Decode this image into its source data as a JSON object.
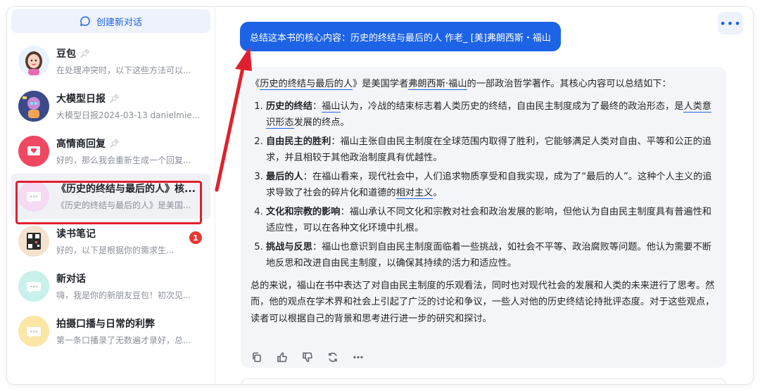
{
  "sidebar": {
    "new_chat_label": "创建新对话",
    "conversations": [
      {
        "title": "豆包",
        "preview": "在处理冲突时，以下这些方法可以...",
        "pinned": true,
        "avatar": "girl-avatar",
        "avatar_bg": "#e9f2ff"
      },
      {
        "title": "大模型日报",
        "preview": "大模型日报2024-03-13 danielmie...",
        "pinned": true,
        "avatar": "robot-avatar",
        "avatar_bg": "#3b4b8a"
      },
      {
        "title": "高情商回复",
        "preview": "好的，那么我会重新生成一个回复...",
        "pinned": true,
        "avatar": "heart-envelope-avatar",
        "avatar_bg": "#ef4860"
      },
      {
        "title": "《历史的终结与最后的人》核...",
        "preview": "《历史的终结与最后的人》是美国...",
        "pinned": false,
        "avatar": "chat-bubble-avatar",
        "avatar_bg": "#f6d9f3",
        "selected": true
      },
      {
        "title": "读书笔记",
        "preview": "好的，以下是根据你的需求生...",
        "pinned": false,
        "avatar": "qr-avatar",
        "avatar_bg": "#f4e2cf",
        "badge": "1"
      },
      {
        "title": "新对话",
        "preview": "嗨，我是你的新朋友豆包！初次见...",
        "pinned": false,
        "avatar": "chat-bubble-avatar",
        "avatar_bg": "#c7f1ea"
      },
      {
        "title": "拍摄口播与日常的利弊",
        "preview": "第一条口播录了无数遍才录好，总...",
        "pinned": false,
        "avatar": "chat-bubble-avatar",
        "avatar_bg": "#fbe6a6"
      }
    ]
  },
  "main": {
    "more_label": "•••",
    "user_message": "总结这本书的核心内容：历史的终结与最后的人 作老_ [美]弗朗西斯・福山",
    "answer": {
      "intro_1": "《",
      "intro_link_1": "历史的终结与最后的人",
      "intro_2": "》是美国学者",
      "intro_link_2": "弗朗西斯·福山",
      "intro_3": "的一部政治哲学著作。其核心内容可以总结如下：",
      "points": [
        {
          "head": "历史的终结",
          "sep": "：",
          "pre": "",
          "link": "福山",
          "body": "认为，冷战的结束标志着人类历史的终结，自由民主制度成为了最终的政治形态，是",
          "link2": "人类意识形态",
          "tail": "发展的终点。"
        },
        {
          "head": "自由民主的胜利",
          "sep": "：",
          "pre": "",
          "link": "",
          "body": "福山主张自由民主制度在全球范围内取得了胜利，它能够满足人类对自由、平等和公正的追求，并且相较于其他政治制度具有优越性。",
          "link2": "",
          "tail": ""
        },
        {
          "head": "最后的人",
          "sep": "：",
          "pre": "",
          "link": "",
          "body": "在福山看来，现代社会中，人们追求物质享受和自我实现，成为了“最后的人”。这种个人主义的追求导致了社会的碎片化和道德的",
          "link2": "相对主义",
          "tail": "。"
        },
        {
          "head": "文化和宗教的影响",
          "sep": "：",
          "pre": "",
          "link": "",
          "body": "福山承认不同文化和宗教对社会和政治发展的影响，但他认为自由民主制度具有普遍性和适应性，可以在各种文化环境中扎根。",
          "link2": "",
          "tail": ""
        },
        {
          "head": "挑战与反思",
          "sep": "：",
          "pre": "",
          "link": "",
          "body": "福山也意识到自由民主制度面临着一些挑战，如社会不平等、政治腐败等问题。他认为需要不断地反思和改进自由民主制度，以确保其持续的活力和适应性。",
          "link2": "",
          "tail": ""
        }
      ],
      "summary": "总的来说，福山在书中表达了对自由民主制度的乐观看法，同时也对现代社会的发展和人类的未来进行了思考。然而，他的观点在学术界和社会上引起了广泛的讨论和争议，一些人对他的历史终结论持批评态度。对于这些观点，读者可以根据自己的背景和思考进行进一步的研究和探讨。"
    },
    "toolbar_icons": [
      "copy-icon",
      "thumbs-up-icon",
      "thumbs-down-icon",
      "regenerate-icon",
      "more-icon"
    ]
  },
  "colors": {
    "accent": "#1d63e6",
    "highlight": "#e0202e",
    "badge": "#e53935"
  }
}
